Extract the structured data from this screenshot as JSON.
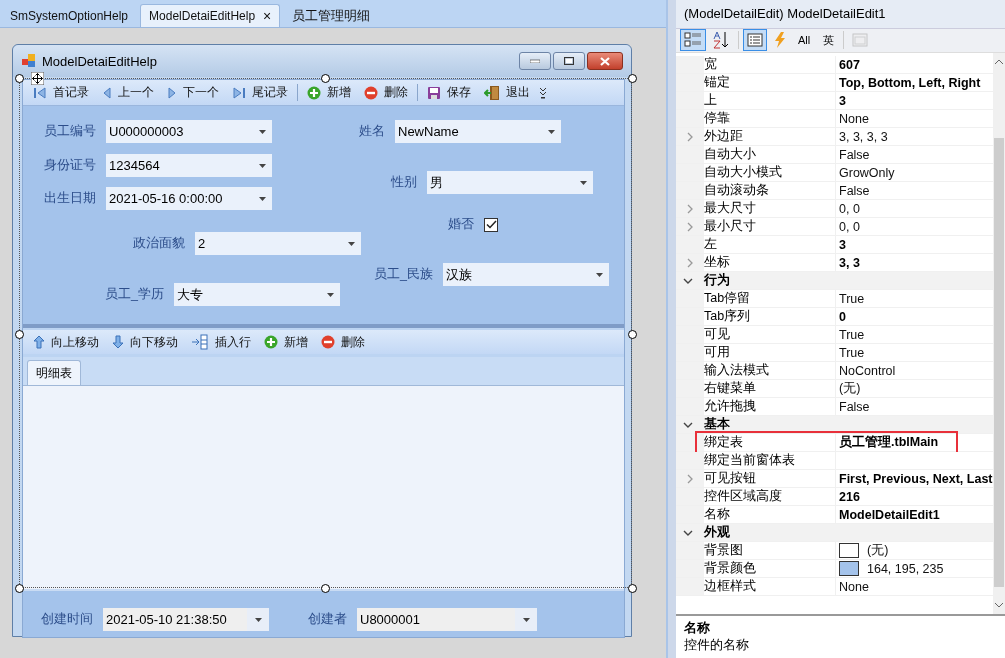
{
  "doc_tabs": [
    {
      "label": "SmSystemOptionHelp",
      "selected": false
    },
    {
      "label": "ModelDetaiEditHelp",
      "selected": true,
      "close": "×"
    },
    {
      "label": "员工管理明细",
      "selected": false
    }
  ],
  "form_window": {
    "title": "ModelDetaiEditHelp",
    "nav_toolbar": [
      {
        "kind": "button",
        "label": "首记录"
      },
      {
        "kind": "button",
        "label": "上一个"
      },
      {
        "kind": "button",
        "label": "下一个"
      },
      {
        "kind": "button",
        "label": "尾记录"
      },
      {
        "kind": "separator"
      },
      {
        "kind": "button",
        "label": "新增"
      },
      {
        "kind": "button",
        "label": "删除"
      },
      {
        "kind": "separator"
      },
      {
        "kind": "button",
        "label": "保存"
      },
      {
        "kind": "button",
        "label": "退出"
      }
    ],
    "fields": [
      {
        "kind": "combo",
        "label": "员工编号",
        "value": "U000000003",
        "disabled": false
      },
      {
        "kind": "combo",
        "label": "姓名",
        "value": "NewName",
        "disabled": false
      },
      {
        "kind": "combo",
        "label": "身份证号",
        "value": "1234564",
        "disabled": false
      },
      {
        "kind": "combo",
        "label": "性别",
        "value": "男",
        "disabled": false
      },
      {
        "kind": "combo",
        "label": "出生日期",
        "value": "2021-05-16 0:00:00",
        "disabled": false
      },
      {
        "kind": "checkbox",
        "label": "婚否",
        "checked": true
      },
      {
        "kind": "combo",
        "label": "政治面貌",
        "value": "2",
        "disabled": false
      },
      {
        "kind": "combo",
        "label": "员工_民族",
        "value": "汉族",
        "disabled": false
      },
      {
        "kind": "combo",
        "label": "员工_学历",
        "value": "大专",
        "disabled": false
      }
    ],
    "detail_toolbar": [
      {
        "label": "向上移动"
      },
      {
        "label": "向下移动"
      },
      {
        "label": "插入行"
      },
      {
        "label": "新增"
      },
      {
        "label": "删除"
      }
    ],
    "detail_tabs": [
      {
        "label": "明细表",
        "selected": true
      }
    ],
    "footer_fields": [
      {
        "label": "创建时间",
        "value": "2021-05-10 21:38:50",
        "disabled": true
      },
      {
        "label": "创建者",
        "value": "U8000001",
        "disabled": true
      }
    ]
  },
  "properties": {
    "object": "(ModelDetailEdit) ModelDetailEdit1",
    "toolbar": [
      {
        "kind": "icon",
        "selected": true
      },
      {
        "kind": "icon",
        "selected": false
      },
      {
        "kind": "separator"
      },
      {
        "kind": "icon",
        "selected": true
      },
      {
        "kind": "icon",
        "selected": false
      },
      {
        "kind": "text",
        "label": "All",
        "selected": false
      },
      {
        "kind": "text",
        "label": "英",
        "selected": false
      },
      {
        "kind": "separator"
      },
      {
        "kind": "icon",
        "selected": false,
        "disabled": true
      }
    ],
    "rows": [
      {
        "kind": "prop",
        "name": "宽",
        "value": "607",
        "modified": true,
        "marked": false
      },
      {
        "kind": "prop",
        "name": "锚定",
        "value": "Top, Bottom, Left, Right",
        "modified": true,
        "marked": false
      },
      {
        "kind": "prop",
        "name": "上",
        "value": "3",
        "modified": true,
        "marked": false
      },
      {
        "kind": "prop",
        "name": "停靠",
        "value": "None",
        "modified": false,
        "marked": false
      },
      {
        "kind": "group",
        "name": "外边距",
        "value": "3, 3, 3, 3",
        "modified": false,
        "expanded": false,
        "marked": false
      },
      {
        "kind": "prop",
        "name": "自动大小",
        "value": "False",
        "modified": false,
        "marked": false
      },
      {
        "kind": "prop",
        "name": "自动大小模式",
        "value": "GrowOnly",
        "modified": false,
        "marked": false
      },
      {
        "kind": "prop",
        "name": "自动滚动条",
        "value": "False",
        "modified": false,
        "marked": false
      },
      {
        "kind": "group",
        "name": "最大尺寸",
        "value": "0, 0",
        "modified": false,
        "expanded": false,
        "marked": false
      },
      {
        "kind": "group",
        "name": "最小尺寸",
        "value": "0, 0",
        "modified": false,
        "expanded": false,
        "marked": false
      },
      {
        "kind": "prop",
        "name": "左",
        "value": "3",
        "modified": true,
        "marked": false
      },
      {
        "kind": "group",
        "name": "坐标",
        "value": "3, 3",
        "modified": true,
        "expanded": false,
        "marked": false
      },
      {
        "kind": "category",
        "name": "行为",
        "expanded": true
      },
      {
        "kind": "prop",
        "name": "Tab停留",
        "value": "True",
        "modified": false,
        "marked": false
      },
      {
        "kind": "prop",
        "name": "Tab序列",
        "value": "0",
        "modified": true,
        "marked": false
      },
      {
        "kind": "prop",
        "name": "可见",
        "value": "True",
        "modified": false,
        "marked": false
      },
      {
        "kind": "prop",
        "name": "可用",
        "value": "True",
        "modified": false,
        "marked": false
      },
      {
        "kind": "prop",
        "name": "输入法模式",
        "value": "NoControl",
        "modified": false,
        "marked": false
      },
      {
        "kind": "prop",
        "name": "右键菜单",
        "value": "(无)",
        "modified": false,
        "marked": false
      },
      {
        "kind": "prop",
        "name": "允许拖拽",
        "value": "False",
        "modified": false,
        "marked": false
      },
      {
        "kind": "category",
        "name": "基本",
        "expanded": true
      },
      {
        "kind": "prop",
        "name": "绑定表",
        "value": "员工管理.tblMain",
        "modified": true,
        "marked": true
      },
      {
        "kind": "prop",
        "name": "绑定当前窗体表",
        "marked": false
      },
      {
        "kind": "group",
        "name": "可见按钮",
        "value": "First, Previous, Next, Last",
        "modified": true,
        "expanded": false,
        "marked": false
      },
      {
        "kind": "prop",
        "name": "控件区域高度",
        "value": "216",
        "modified": true,
        "marked": false
      },
      {
        "kind": "prop",
        "name": "名称",
        "value": "ModelDetailEdit1",
        "modified": true,
        "marked": false
      },
      {
        "kind": "category",
        "name": "外观",
        "expanded": true
      },
      {
        "kind": "prop",
        "name": "背景图",
        "value": "(无)",
        "modified": false,
        "marked": false,
        "color": "#ffffff"
      },
      {
        "kind": "prop",
        "name": "背景颜色",
        "value": "164, 195, 235",
        "modified": false,
        "marked": false,
        "color": "#a4c3eb"
      },
      {
        "kind": "prop",
        "name": "边框样式",
        "value": "None",
        "modified": false,
        "marked": false
      }
    ],
    "description": {
      "title": "名称",
      "text": "控件的名称"
    }
  }
}
